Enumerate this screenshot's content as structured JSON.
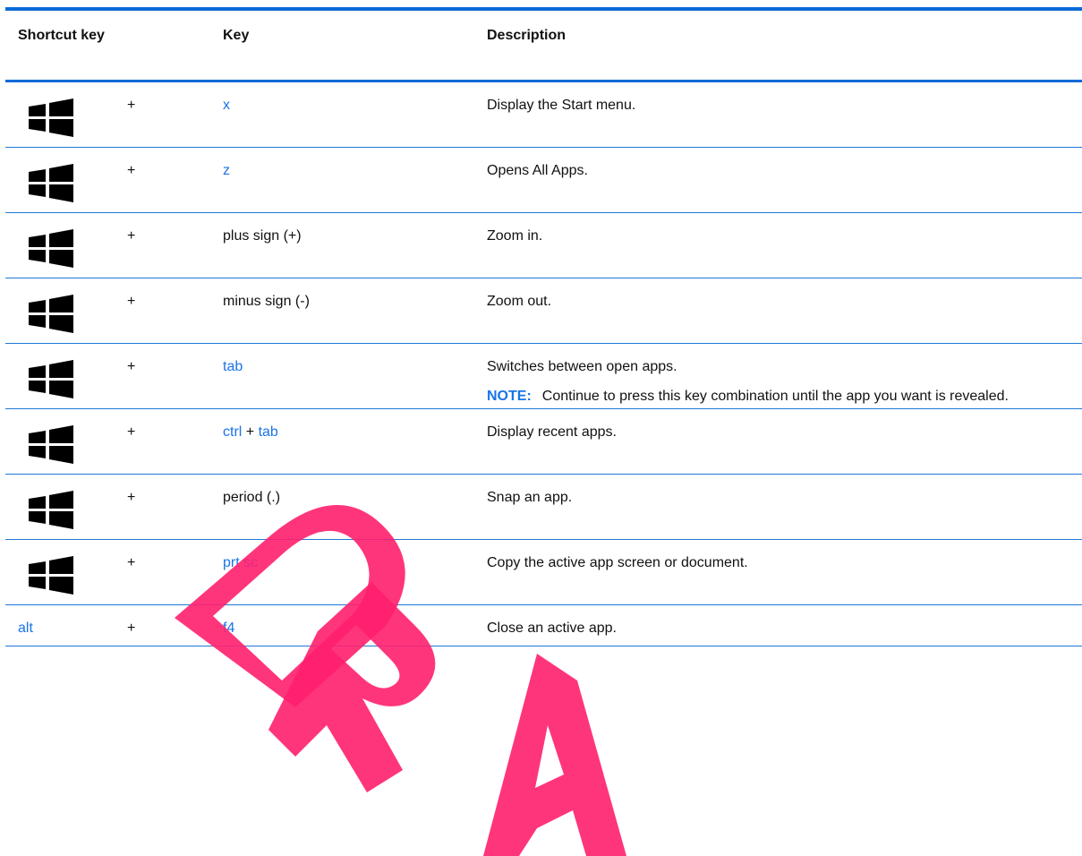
{
  "header": {
    "shortcut_key": "Shortcut key",
    "key": "Key",
    "description": "Description"
  },
  "rows": [
    {
      "shortcut": "windows-key",
      "plus": "+",
      "key": "x",
      "key_is_link": true,
      "description": "Display the Start menu."
    },
    {
      "shortcut": "windows-key",
      "plus": "+",
      "key": "z",
      "key_is_link": true,
      "description": "Opens All Apps."
    },
    {
      "shortcut": "windows-key",
      "plus": "+",
      "key": "plus sign (+)",
      "key_is_link": false,
      "description": "Zoom in."
    },
    {
      "shortcut": "windows-key",
      "plus": "+",
      "key": "minus sign (-)",
      "key_is_link": false,
      "description": "Zoom out."
    },
    {
      "shortcut": "windows-key",
      "plus": "+",
      "key": "tab",
      "key_is_link": true,
      "description": "Switches between open apps.",
      "note_label": "NOTE:",
      "note_text": "Continue to press this key combination until the app you want is revealed."
    },
    {
      "shortcut": "windows-key",
      "plus": "+",
      "key_parts": [
        "ctrl",
        "+",
        "tab"
      ],
      "description": "Display recent apps."
    },
    {
      "shortcut": "windows-key",
      "plus": "+",
      "key": "period (.)",
      "key_is_link": false,
      "description": "Snap an app."
    },
    {
      "shortcut": "windows-key",
      "plus": "+",
      "key": "prt sc",
      "key_is_link": true,
      "description": "Copy the active app screen or document."
    },
    {
      "shortcut_text": "alt",
      "plus": "+",
      "key": "f4",
      "key_is_link": true,
      "description": "Close an active app."
    }
  ],
  "watermark_text": "DRAFT",
  "colors": {
    "accent_blue": "#0a6ad8",
    "link_blue": "#1a73e8",
    "watermark_pink": "#ff1f6e"
  }
}
